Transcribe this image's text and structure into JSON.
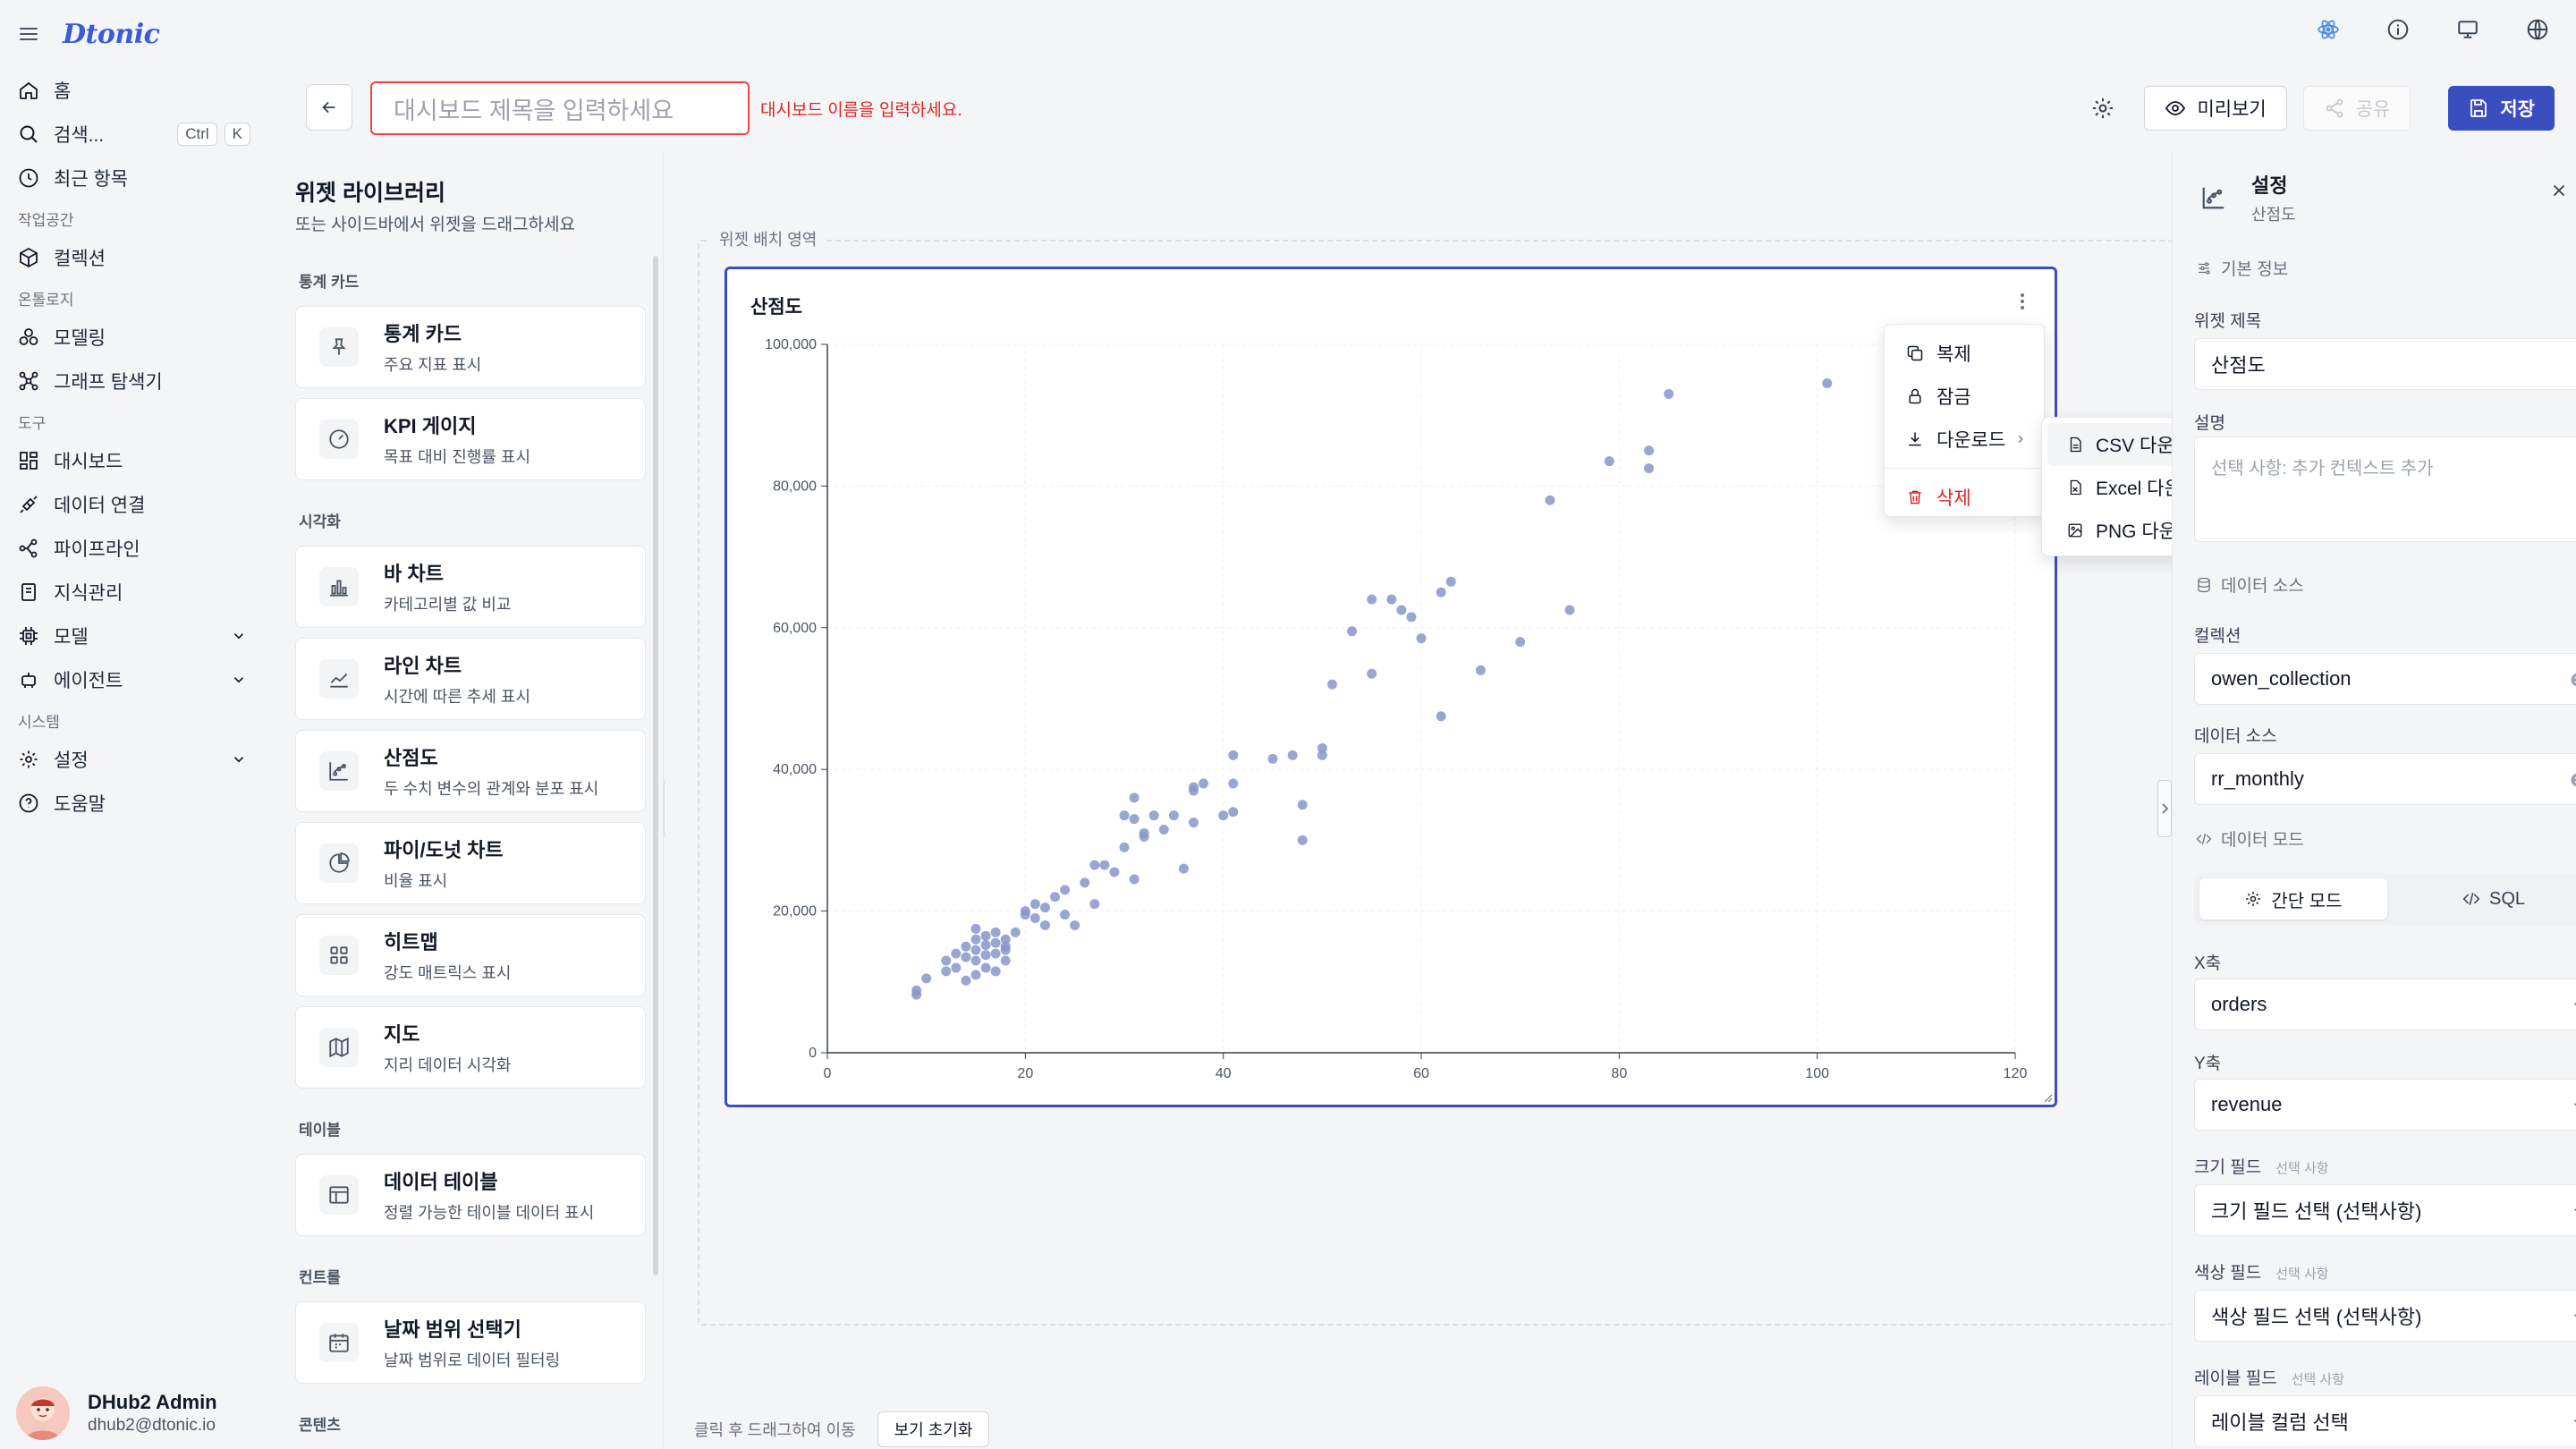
{
  "brand": {
    "logo": "Dtonic"
  },
  "nav": {
    "home": "홈",
    "search": "검색...",
    "kbd_ctrl": "Ctrl",
    "kbd_k": "K",
    "recent": "최근 항목",
    "sec_workspace": "작업공간",
    "collections": "컬렉션",
    "sec_ontology": "온톨로지",
    "modeling": "모델링",
    "graph_explorer": "그래프 탐색기",
    "sec_tools": "도구",
    "dashboard": "대시보드",
    "data_connect": "데이터 연결",
    "pipeline": "파이프라인",
    "knowledge": "지식관리",
    "model": "모델",
    "agent": "에이전트",
    "sec_system": "시스템",
    "settings": "설정",
    "help": "도움말"
  },
  "user": {
    "name": "DHub2 Admin",
    "email": "dhub2@dtonic.io"
  },
  "header": {
    "title_placeholder": "대시보드 제목을 입력하세요",
    "title_error": "대시보드 이름을 입력하세요.",
    "preview": "미리보기",
    "share": "공유",
    "save": "저장"
  },
  "library": {
    "title": "위젯 라이브러리",
    "subtitle": "또는 사이드바에서 위젯을 드래그하세요",
    "sections": [
      {
        "name": "통계 카드",
        "items": [
          {
            "icon": "pin-icon",
            "title": "통계 카드",
            "desc": "주요 지표 표시"
          },
          {
            "icon": "gauge-icon",
            "title": "KPI 게이지",
            "desc": "목표 대비 진행률 표시"
          }
        ]
      },
      {
        "name": "시각화",
        "items": [
          {
            "icon": "bar-chart-icon",
            "title": "바 차트",
            "desc": "카테고리별 값 비교"
          },
          {
            "icon": "line-chart-icon",
            "title": "라인 차트",
            "desc": "시간에 따른 추세 표시"
          },
          {
            "icon": "scatter-chart-icon",
            "title": "산점도",
            "desc": "두 수치 변수의 관계와 분포 표시"
          },
          {
            "icon": "pie-chart-icon",
            "title": "파이/도넛 차트",
            "desc": "비율 표시"
          },
          {
            "icon": "grid-icon",
            "title": "히트맵",
            "desc": "강도 매트릭스 표시"
          },
          {
            "icon": "map-icon",
            "title": "지도",
            "desc": "지리 데이터 시각화"
          }
        ]
      },
      {
        "name": "테이블",
        "items": [
          {
            "icon": "table-icon",
            "title": "데이터 테이블",
            "desc": "정렬 가능한 테이블 데이터 표시"
          }
        ]
      },
      {
        "name": "컨트롤",
        "items": [
          {
            "icon": "calendar-icon",
            "title": "날짜 범위 선택기",
            "desc": "날짜 범위로 데이터 필터링"
          }
        ]
      },
      {
        "name": "콘텐츠",
        "items": []
      }
    ]
  },
  "canvas": {
    "zone_label": "위젯 배치 영역",
    "widget_title": "산점도",
    "foot_hint": "클릭 후 드래그하여 이동",
    "reset_view": "보기 초기화"
  },
  "context_menu": {
    "duplicate": "복제",
    "lock": "잠금",
    "download": "다운로드",
    "delete": "삭제",
    "csv": "CSV 다운로드",
    "excel": "Excel 다운로드",
    "png": "PNG 다운로드"
  },
  "panel": {
    "title": "설정",
    "subtitle": "산점도",
    "sec_basic": "기본 정보",
    "widget_title_label": "위젯 제목",
    "widget_title_value": "산점도",
    "desc_label": "설명",
    "desc_placeholder": "선택 사항: 추가 컨텍스트 추가",
    "sec_source": "데이터 소스",
    "collection_label": "컬렉션",
    "collection_value": "owen_collection",
    "source_label": "데이터 소스",
    "source_value": "rr_monthly",
    "sec_mode": "데이터 모드",
    "mode_simple": "간단 모드",
    "mode_sql": "SQL",
    "x_label": "X축",
    "x_value": "orders",
    "y_label": "Y축",
    "y_value": "revenue",
    "size_label": "크기 필드",
    "size_value": "크기 필드 선택 (선택사항)",
    "color_label": "색상 필드",
    "color_value": "색상 필드 선택 (선택사항)",
    "label_label": "레이블 필드",
    "label_value": "레이블 컬럼 선택",
    "optional": "선택 사항"
  },
  "colors": {
    "accent": "#3b4ebf",
    "error": "#dc2626",
    "point": "#8797c9"
  },
  "chart_data": {
    "type": "scatter",
    "xlim": [
      0,
      120
    ],
    "ylim": [
      0,
      100000
    ],
    "xticks": [
      0,
      20,
      40,
      60,
      80,
      100,
      120
    ],
    "yticks": [
      0,
      20000,
      40000,
      60000,
      80000,
      100000
    ],
    "ytick_labels": [
      "0",
      "20,000",
      "40,000",
      "60,000",
      "80,000",
      "100,000"
    ],
    "points": [
      [
        9,
        8200
      ],
      [
        9,
        8800
      ],
      [
        10,
        10500
      ],
      [
        12,
        11500
      ],
      [
        12,
        13000
      ],
      [
        13,
        14000
      ],
      [
        13,
        12000
      ],
      [
        14,
        10200
      ],
      [
        14,
        13500
      ],
      [
        14,
        15000
      ],
      [
        15,
        11000
      ],
      [
        15,
        13000
      ],
      [
        15,
        14500
      ],
      [
        15,
        16000
      ],
      [
        15,
        17500
      ],
      [
        16,
        12000
      ],
      [
        16,
        13800
      ],
      [
        16,
        15200
      ],
      [
        16,
        16500
      ],
      [
        17,
        11500
      ],
      [
        17,
        14000
      ],
      [
        17,
        15500
      ],
      [
        17,
        17000
      ],
      [
        18,
        13000
      ],
      [
        18,
        14500
      ],
      [
        18,
        16000
      ],
      [
        18,
        15000
      ],
      [
        19,
        17000
      ],
      [
        20,
        19500
      ],
      [
        20,
        20000
      ],
      [
        21,
        21000
      ],
      [
        21,
        19000
      ],
      [
        22,
        18000
      ],
      [
        22,
        20500
      ],
      [
        23,
        22000
      ],
      [
        24,
        19500
      ],
      [
        24,
        23000
      ],
      [
        25,
        18000
      ],
      [
        26,
        24000
      ],
      [
        27,
        26500
      ],
      [
        27,
        21000
      ],
      [
        28,
        26500
      ],
      [
        29,
        25500
      ],
      [
        30,
        29000
      ],
      [
        30,
        33500
      ],
      [
        31,
        36000
      ],
      [
        31,
        24500
      ],
      [
        31,
        33000
      ],
      [
        32,
        30500
      ],
      [
        32,
        31000
      ],
      [
        33,
        33500
      ],
      [
        34,
        31500
      ],
      [
        35,
        33500
      ],
      [
        36,
        26000
      ],
      [
        37,
        32500
      ],
      [
        37,
        37000
      ],
      [
        37,
        37500
      ],
      [
        38,
        38000
      ],
      [
        40,
        33500
      ],
      [
        41,
        42000
      ],
      [
        41,
        34000
      ],
      [
        41,
        38000
      ],
      [
        45,
        41500
      ],
      [
        47,
        42000
      ],
      [
        48,
        35000
      ],
      [
        48,
        30000
      ],
      [
        50,
        43000
      ],
      [
        50,
        42000
      ],
      [
        51,
        52000
      ],
      [
        53,
        59500
      ],
      [
        55,
        64000
      ],
      [
        55,
        53500
      ],
      [
        57,
        64000
      ],
      [
        58,
        62500
      ],
      [
        59,
        61500
      ],
      [
        60,
        58500
      ],
      [
        62,
        47500
      ],
      [
        62,
        65000
      ],
      [
        63,
        66500
      ],
      [
        66,
        54000
      ],
      [
        70,
        58000
      ],
      [
        73,
        78000
      ],
      [
        75,
        62500
      ],
      [
        79,
        83500
      ],
      [
        83,
        85000
      ],
      [
        83,
        82500
      ],
      [
        85,
        93000
      ],
      [
        101,
        94500
      ]
    ]
  }
}
